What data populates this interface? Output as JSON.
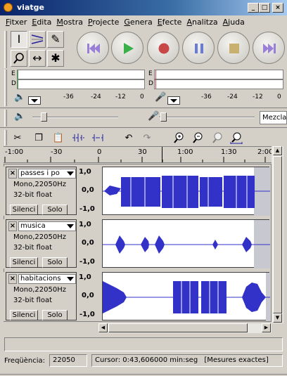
{
  "window": {
    "title": "viatge"
  },
  "menu": [
    {
      "pre": "",
      "u": "F",
      "post": "itxer"
    },
    {
      "pre": "",
      "u": "E",
      "post": "dita"
    },
    {
      "pre": "",
      "u": "M",
      "post": "ostra"
    },
    {
      "pre": "",
      "u": "P",
      "post": "rojecte"
    },
    {
      "pre": "",
      "u": "G",
      "post": "enera"
    },
    {
      "pre": "",
      "u": "E",
      "post": "fecte"
    },
    {
      "pre": "",
      "u": "A",
      "post": "nalitza"
    },
    {
      "pre": "",
      "u": "A",
      "post": "juda"
    }
  ],
  "meters": {
    "left_letters": [
      "E",
      "D"
    ],
    "right_letters": [
      "E",
      "D"
    ],
    "scale": [
      "-36",
      "-24",
      "-12",
      "0"
    ]
  },
  "mixer": {
    "source": "Mezcla"
  },
  "ruler": {
    "labels": [
      "-1:00",
      "-30",
      "0",
      "30",
      "1:00",
      "1:30",
      "2:00"
    ]
  },
  "tracks": [
    {
      "name": "passes i po",
      "info1": "Mono,22050Hz",
      "info2": "32-bit float",
      "mute": "Silenci",
      "solo": "Solo",
      "scale": [
        "1,0",
        "0,0",
        "-1,0"
      ]
    },
    {
      "name": "musica",
      "info1": "Mono,22050Hz",
      "info2": "32-bit float",
      "mute": "Silenci",
      "solo": "Solo",
      "scale": [
        "1,0",
        "0,0",
        "-1,0"
      ]
    },
    {
      "name": "habitacions",
      "info1": "Mono,22050Hz",
      "info2": "32-bit float",
      "mute": "Silenci",
      "solo": "Solo",
      "scale": [
        "1,0",
        "0,0",
        "-1,0"
      ]
    }
  ],
  "status": {
    "freq_label": "Freqüència:",
    "freq_value": "22050",
    "cursor": "Cursor: 0:43,606000 min:seg",
    "mode": "[Mesures exactes]"
  },
  "colors": {
    "wave": "#3232c8",
    "selection": "#ffffff",
    "accent": "#0a246a"
  }
}
